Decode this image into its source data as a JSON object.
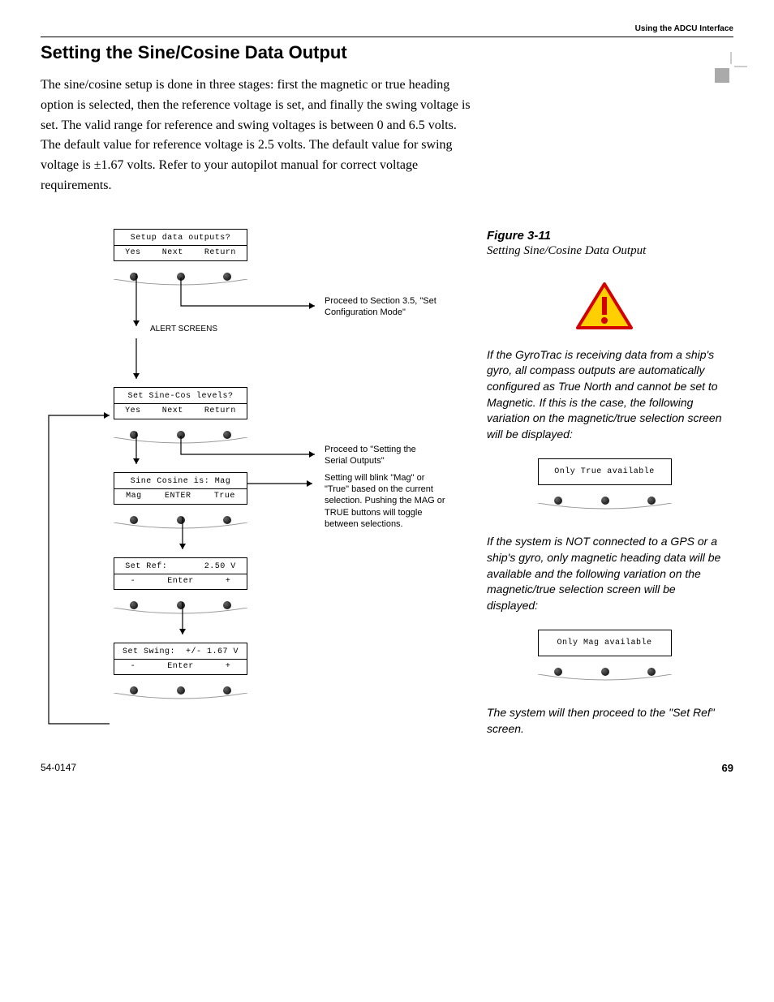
{
  "header": {
    "title": "Using the ADCU Interface"
  },
  "section": {
    "title": "Setting the Sine/Cosine Data Output",
    "body": "The sine/cosine setup is done in three stages: first the magnetic or true heading option is selected, then the reference voltage is set, and finally the swing voltage is set. The valid range for reference and swing voltages is between 0 and 6.5 volts. The default value for reference voltage is 2.5 volts. The default value for swing voltage is ±1.67 volts. Refer to your autopilot manual for correct voltage requirements."
  },
  "diagram": {
    "alert_screens_label": "ALERT SCREENS",
    "note_config": "Proceed to Section 3.5, \"Set Configuration Mode\"",
    "note_serial": "Proceed to \"Setting the Serial Outputs\"",
    "note_toggle": "Setting will blink \"Mag\" or \"True\" based on the current selection. Pushing the MAG or TRUE buttons will toggle between selections.",
    "screens": {
      "setup": {
        "line1": "Setup data outputs?",
        "b1": "Yes",
        "b2": "Next",
        "b3": "Return"
      },
      "sincos": {
        "line1": "Set Sine-Cos levels?",
        "b1": "Yes",
        "b2": "Next",
        "b3": "Return"
      },
      "magtrue": {
        "line1": "Sine Cosine is: Mag",
        "b1": "Mag",
        "b2": "ENTER",
        "b3": "True"
      },
      "setref": {
        "line1": "Set Ref:       2.50 V",
        "b1": "-",
        "b2": "Enter",
        "b3": "+"
      },
      "setswing": {
        "line1": "Set Swing:  +/- 1.67 V",
        "b1": "-",
        "b2": "Enter",
        "b3": "+"
      }
    }
  },
  "sidebar": {
    "figure_title": "Figure 3-11",
    "figure_caption": "Setting Sine/Cosine Data Output",
    "note1": "If the GyroTrac is receiving data from a ship's gyro, all compass outputs are automatically configured as True North and cannot be set to Magnetic. If this is the case, the following variation on the magnetic/true selection screen will be displayed:",
    "screen_true": "Only True available",
    "note2": "If the system is NOT connected to a GPS or a ship's gyro, only magnetic heading data will be available and the following variation on the magnetic/true selection screen will be displayed:",
    "screen_mag": "Only Mag available",
    "note3": "The system will then proceed to the \"Set Ref\" screen."
  },
  "footer": {
    "docnum": "54-0147",
    "pagenum": "69"
  }
}
